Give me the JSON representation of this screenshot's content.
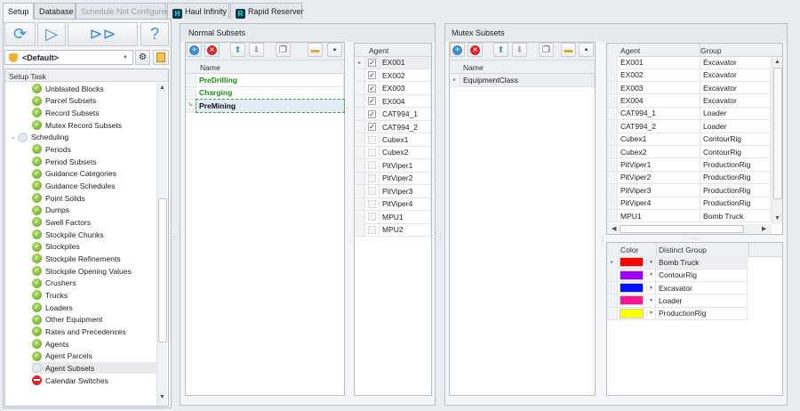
{
  "tabs": [
    {
      "label": "Setup",
      "state": "active"
    },
    {
      "label": "Database",
      "state": "normal"
    },
    {
      "label": "Schedule Not Configured",
      "state": "disabled"
    },
    {
      "label": "Haul Infinity",
      "state": "normal",
      "logo": "H"
    },
    {
      "label": "Rapid Reserver",
      "state": "normal",
      "logo": "R"
    }
  ],
  "left": {
    "profile": "<Default>",
    "tree_header": "Setup Task",
    "tree": [
      {
        "label": "Unblasted Blocks",
        "status": "ok"
      },
      {
        "label": "Parcel Subsets",
        "status": "ok"
      },
      {
        "label": "Record Subsets",
        "status": "ok"
      },
      {
        "label": "Mutex Record Subsets",
        "status": "ok"
      },
      {
        "label": "Scheduling",
        "status": "pending",
        "group": true
      },
      {
        "label": "Periods",
        "status": "ok"
      },
      {
        "label": "Period Subsets",
        "status": "ok"
      },
      {
        "label": "Guidance Categories",
        "status": "ok"
      },
      {
        "label": "Guidance Schedules",
        "status": "ok"
      },
      {
        "label": "Point Solids",
        "status": "ok"
      },
      {
        "label": "Dumps",
        "status": "ok"
      },
      {
        "label": "Swell Factors",
        "status": "ok"
      },
      {
        "label": "Stockpile Chunks",
        "status": "ok"
      },
      {
        "label": "Stockpiles",
        "status": "ok"
      },
      {
        "label": "Stockpile Refinements",
        "status": "ok"
      },
      {
        "label": "Stockpile Opening Values",
        "status": "ok"
      },
      {
        "label": "Crushers",
        "status": "ok"
      },
      {
        "label": "Trucks",
        "status": "ok"
      },
      {
        "label": "Loaders",
        "status": "ok"
      },
      {
        "label": "Other Equipment",
        "status": "ok"
      },
      {
        "label": "Rates and Precedences",
        "status": "ok"
      },
      {
        "label": "Agents",
        "status": "ok"
      },
      {
        "label": "Agent Parcels",
        "status": "ok"
      },
      {
        "label": "Agent Subsets",
        "status": "pending",
        "selected": true
      },
      {
        "label": "Calendar Switches",
        "status": "error"
      }
    ]
  },
  "normal": {
    "title": "Normal Subsets",
    "name_header": "Name",
    "rows": [
      {
        "name": "PreDrilling",
        "color": "#1a8a1a"
      },
      {
        "name": "Charging",
        "color": "#1a8a1a"
      },
      {
        "name": "PreMining",
        "color": "#111111",
        "editing": true
      }
    ],
    "agent_header": "Agent",
    "agents": [
      {
        "name": "EX001",
        "checked": true
      },
      {
        "name": "EX002",
        "checked": true
      },
      {
        "name": "EX003",
        "checked": true
      },
      {
        "name": "EX004",
        "checked": true
      },
      {
        "name": "CAT994_1",
        "checked": true
      },
      {
        "name": "CAT994_2",
        "checked": true
      },
      {
        "name": "Cubex1",
        "checked": false
      },
      {
        "name": "Cubex2",
        "checked": false
      },
      {
        "name": "PitViper1",
        "checked": false
      },
      {
        "name": "PitViper2",
        "checked": false
      },
      {
        "name": "PitViper3",
        "checked": false
      },
      {
        "name": "PitViper4",
        "checked": false
      },
      {
        "name": "MPU1",
        "checked": false
      },
      {
        "name": "MPU2",
        "checked": false
      }
    ]
  },
  "mutex": {
    "title": "Mutex Subsets",
    "name_header": "Name",
    "rows": [
      {
        "name": "EquipmentClass"
      }
    ],
    "agent_header": "Agent",
    "group_header": "Group",
    "agents": [
      [
        "EX001",
        "Excavator"
      ],
      [
        "EX002",
        "Excavator"
      ],
      [
        "EX003",
        "Excavator"
      ],
      [
        "EX004",
        "Excavator"
      ],
      [
        "CAT994_1",
        "Loader"
      ],
      [
        "CAT994_2",
        "Loader"
      ],
      [
        "Cubex1",
        "ContourRig"
      ],
      [
        "Cubex2",
        "ContourRig"
      ],
      [
        "PitViper1",
        "ProductionRig"
      ],
      [
        "PitViper2",
        "ProductionRig"
      ],
      [
        "PitViper3",
        "ProductionRig"
      ],
      [
        "PitViper4",
        "ProductionRig"
      ],
      [
        "MPU1",
        "Bomb Truck"
      ]
    ],
    "color_header": "Color",
    "distinct_header": "Distinct Group",
    "groups": [
      {
        "name": "Bomb Truck",
        "color": "#ff0000"
      },
      {
        "name": "ContourRig",
        "color": "#a000ff"
      },
      {
        "name": "Excavator",
        "color": "#0010ff"
      },
      {
        "name": "Loader",
        "color": "#ff1493"
      },
      {
        "name": "ProductionRig",
        "color": "#ffff00"
      }
    ]
  }
}
